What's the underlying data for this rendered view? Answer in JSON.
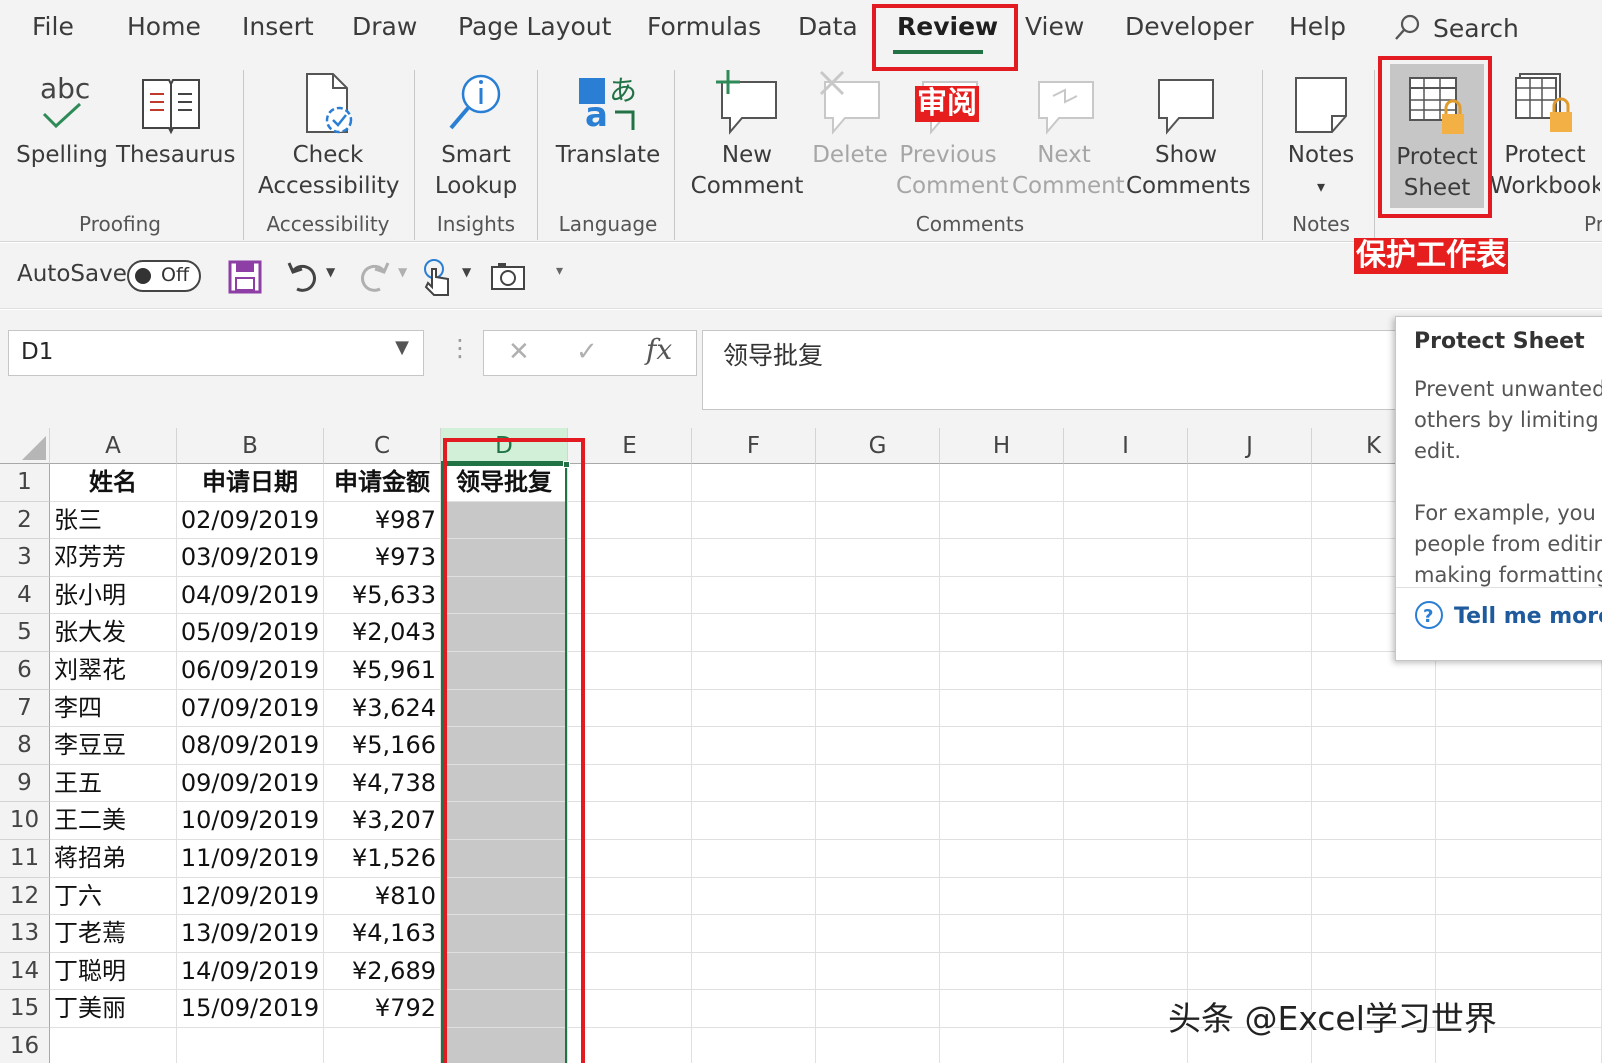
{
  "menu": {
    "tabs": [
      "File",
      "Home",
      "Insert",
      "Draw",
      "Page Layout",
      "Formulas",
      "Data",
      "Review",
      "View",
      "Developer",
      "Help"
    ],
    "active_tab": "Review",
    "search_label": "Search"
  },
  "ribbon": {
    "spelling": "Spelling",
    "thesaurus": "Thesaurus",
    "proofing_group": "Proofing",
    "check": "Check",
    "accessibility": "Accessibility",
    "accessibility_group": "Accessibility",
    "smart": "Smart",
    "lookup": "Lookup",
    "insights_group": "Insights",
    "translate": "Translate",
    "language_group": "Language",
    "new": "New",
    "comment": "Comment",
    "delete": "Delete",
    "previous": "Previous",
    "next": "Next",
    "show": "Show",
    "comments": "Comments",
    "comments_group": "Comments",
    "notes": "Notes",
    "notes_caret": "▾",
    "notes_group": "Notes",
    "protect": "Protect",
    "sheet": "Sheet",
    "workbook": "Workbook",
    "protect_group_partial": "Pr",
    "abc_glyph": "abc",
    "translate_glyph_a": "a",
    "translate_glyph_cjk": "あ"
  },
  "quick_access": {
    "autosave_label": "AutoSave",
    "autosave_state": "Off"
  },
  "formula_bar": {
    "name_box": "D1",
    "cancel_glyph": "✕",
    "enter_glyph": "✓",
    "fx": "fx",
    "content": "领导批复"
  },
  "annotations": {
    "review_cn": "审阅",
    "protect_sheet_cn": "保护工作表"
  },
  "tooltip": {
    "title": "Protect Sheet",
    "lines": [
      "Prevent unwanted",
      "others by limiting",
      "edit.",
      "",
      "For example, you c",
      "people from editin",
      "making formatting"
    ],
    "more": "Tell me more"
  },
  "sheet": {
    "columns": [
      "A",
      "B",
      "C",
      "D",
      "E",
      "F",
      "G",
      "H",
      "I",
      "J",
      "K"
    ],
    "selected_column": "D",
    "headers": [
      "姓名",
      "申请日期",
      "申请金额",
      "领导批复"
    ],
    "rows": [
      [
        "张三",
        "02/09/2019",
        "¥987",
        ""
      ],
      [
        "邓芳芳",
        "03/09/2019",
        "¥973",
        ""
      ],
      [
        "张小明",
        "04/09/2019",
        "¥5,633",
        ""
      ],
      [
        "张大发",
        "05/09/2019",
        "¥2,043",
        ""
      ],
      [
        "刘翠花",
        "06/09/2019",
        "¥5,961",
        ""
      ],
      [
        "李四",
        "07/09/2019",
        "¥3,624",
        ""
      ],
      [
        "李豆豆",
        "08/09/2019",
        "¥5,166",
        ""
      ],
      [
        "王五",
        "09/09/2019",
        "¥4,738",
        ""
      ],
      [
        "王二美",
        "10/09/2019",
        "¥3,207",
        ""
      ],
      [
        "蒋招弟",
        "11/09/2019",
        "¥1,526",
        ""
      ],
      [
        "丁六",
        "12/09/2019",
        "¥810",
        ""
      ],
      [
        "丁老蔫",
        "13/09/2019",
        "¥4,163",
        ""
      ],
      [
        "丁聪明",
        "14/09/2019",
        "¥2,689",
        ""
      ],
      [
        "丁美丽",
        "15/09/2019",
        "¥792",
        ""
      ]
    ],
    "row_numbers": [
      "1",
      "2",
      "3",
      "4",
      "5",
      "6",
      "7",
      "8",
      "9",
      "10",
      "11",
      "12",
      "13",
      "14",
      "15",
      "16"
    ]
  },
  "watermark": "头条 @Excel学习世界",
  "colors": {
    "accent": "#217346",
    "annotation_red": "#e21b23",
    "grey_fill": "#c8c8c8"
  }
}
